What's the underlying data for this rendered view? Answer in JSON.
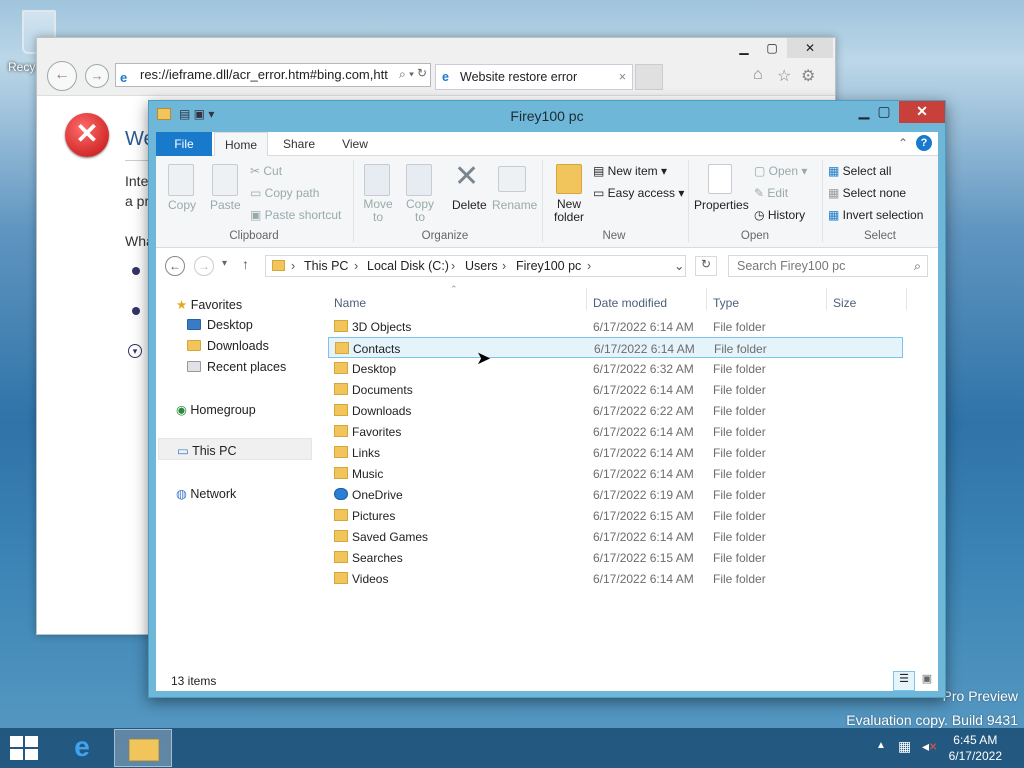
{
  "desktop": {
    "recycle_label": "Recy",
    "watermark_line1": "Pro Preview",
    "watermark_line2": "Evaluation copy. Build 9431"
  },
  "ie": {
    "address": "res://ieframe.dll/acr_error.htm#bing.com,htt",
    "tab_title": "Website restore error",
    "tab_close": "×",
    "page_title": "We",
    "line1": "Inte",
    "line2": "a pr",
    "line3": "Wha"
  },
  "explorer": {
    "title": "Firey100 pc",
    "tabs": [
      "File",
      "Home",
      "Share",
      "View"
    ],
    "clipboard": {
      "copy": "Copy",
      "paste": "Paste",
      "cut": "Cut",
      "copy_path": "Copy path",
      "paste_shortcut": "Paste shortcut",
      "group": "Clipboard"
    },
    "organize": {
      "move_to": "Move to",
      "copy_to": "Copy to",
      "delete": "Delete",
      "rename": "Rename",
      "group": "Organize"
    },
    "new": {
      "new_folder_1": "New",
      "new_folder_2": "folder",
      "new_item": "New item",
      "easy_access": "Easy access",
      "group": "New"
    },
    "open": {
      "properties": "Properties",
      "open": "Open",
      "edit": "Edit",
      "history": "History",
      "group": "Open"
    },
    "select": {
      "select_all": "Select all",
      "select_none": "Select none",
      "invert": "Invert selection",
      "group": "Select"
    },
    "breadcrumb": [
      "This PC",
      "Local Disk (C:)",
      "Users",
      "Firey100 pc"
    ],
    "search_placeholder": "Search Firey100 pc",
    "nav": {
      "favorites": "Favorites",
      "desktop": "Desktop",
      "downloads": "Downloads",
      "recent": "Recent places",
      "homegroup": "Homegroup",
      "thispc": "This PC",
      "network": "Network"
    },
    "columns": {
      "name": "Name",
      "date": "Date modified",
      "type": "Type",
      "size": "Size"
    },
    "files": [
      {
        "name": "3D Objects",
        "date": "6/17/2022 6:14 AM",
        "type": "File folder"
      },
      {
        "name": "Contacts",
        "date": "6/17/2022 6:14 AM",
        "type": "File folder"
      },
      {
        "name": "Desktop",
        "date": "6/17/2022 6:32 AM",
        "type": "File folder"
      },
      {
        "name": "Documents",
        "date": "6/17/2022 6:14 AM",
        "type": "File folder"
      },
      {
        "name": "Downloads",
        "date": "6/17/2022 6:22 AM",
        "type": "File folder"
      },
      {
        "name": "Favorites",
        "date": "6/17/2022 6:14 AM",
        "type": "File folder"
      },
      {
        "name": "Links",
        "date": "6/17/2022 6:14 AM",
        "type": "File folder"
      },
      {
        "name": "Music",
        "date": "6/17/2022 6:14 AM",
        "type": "File folder"
      },
      {
        "name": "OneDrive",
        "date": "6/17/2022 6:19 AM",
        "type": "File folder"
      },
      {
        "name": "Pictures",
        "date": "6/17/2022 6:15 AM",
        "type": "File folder"
      },
      {
        "name": "Saved Games",
        "date": "6/17/2022 6:14 AM",
        "type": "File folder"
      },
      {
        "name": "Searches",
        "date": "6/17/2022 6:15 AM",
        "type": "File folder"
      },
      {
        "name": "Videos",
        "date": "6/17/2022 6:14 AM",
        "type": "File folder"
      }
    ],
    "status": "13 items"
  },
  "taskbar": {
    "time": "6:45 AM",
    "date": "6/17/2022"
  },
  "colors": {
    "accent": "#1979ca",
    "title_bar": "#6fb7d8",
    "close": "#c7403a",
    "selection": "#e5f3fb"
  }
}
